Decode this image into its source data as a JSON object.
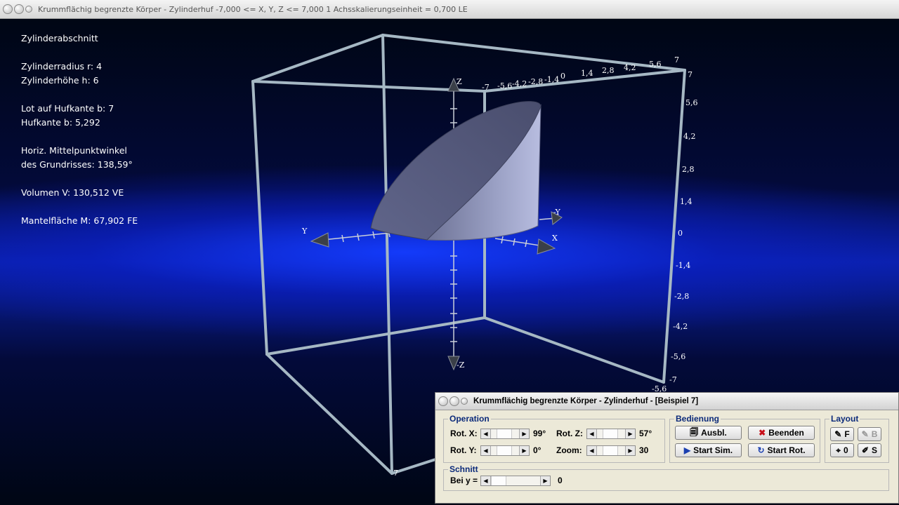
{
  "window": {
    "title": "Krummflächig begrenzte Körper - Zylinderhuf   -7,000 <= X, Y, Z <= 7,000    1 Achsskalierungseinheit = 0,700 LE"
  },
  "info": {
    "heading": "Zylinderabschnitt",
    "radius": "Zylinderradius r: 4",
    "height": "Zylinderhöhe h: 6",
    "lot": "Lot auf Hufkante b: 7",
    "hufkante": "Hufkante b: 5,292",
    "winkel1": "Horiz. Mittelpunktwinkel",
    "winkel2": "des Grundrisses: 138,59°",
    "volumen": "Volumen V: 130,512 VE",
    "mantel": "Mantelfläche M: 67,902 FE"
  },
  "axes": {
    "z_pos": "Z",
    "z_neg": "-Z",
    "y_pos": "Y",
    "y_neg": "-Y",
    "x_pos": "X",
    "top_ticks": [
      "-7",
      "-5,6",
      "-4,2",
      "-2,8",
      "-1,4",
      "0",
      "1,4",
      "2,8",
      "4,2",
      "5,6",
      "7"
    ],
    "right_ticks": [
      "7",
      "5,6",
      "4,2",
      "2,8",
      "1,4",
      "0",
      "-1,4",
      "-2,8",
      "-4,2",
      "-5,6",
      "-7"
    ],
    "bottom_corner": "7",
    "bottom_right": "-5,6"
  },
  "control": {
    "title": "Krummflächig begrenzte Körper - Zylinderhuf - [Beispiel 7]",
    "operation": {
      "legend": "Operation",
      "rotx_label": "Rot. X:",
      "rotx_value": "99°",
      "roty_label": "Rot. Y:",
      "roty_value": "0°",
      "rotz_label": "Rot. Z:",
      "rotz_value": "57°",
      "zoom_label": "Zoom:",
      "zoom_value": "30"
    },
    "bedienung": {
      "legend": "Bedienung",
      "ausbl": "Ausbl.",
      "beenden": "Beenden",
      "start_sim": "Start Sim.",
      "start_rot": "Start Rot."
    },
    "layout": {
      "legend": "Layout",
      "f": "F",
      "b": "B",
      "o": "0",
      "s": "S"
    },
    "schnitt": {
      "legend": "Schnitt",
      "label": "Bei y =",
      "value": "0"
    }
  }
}
